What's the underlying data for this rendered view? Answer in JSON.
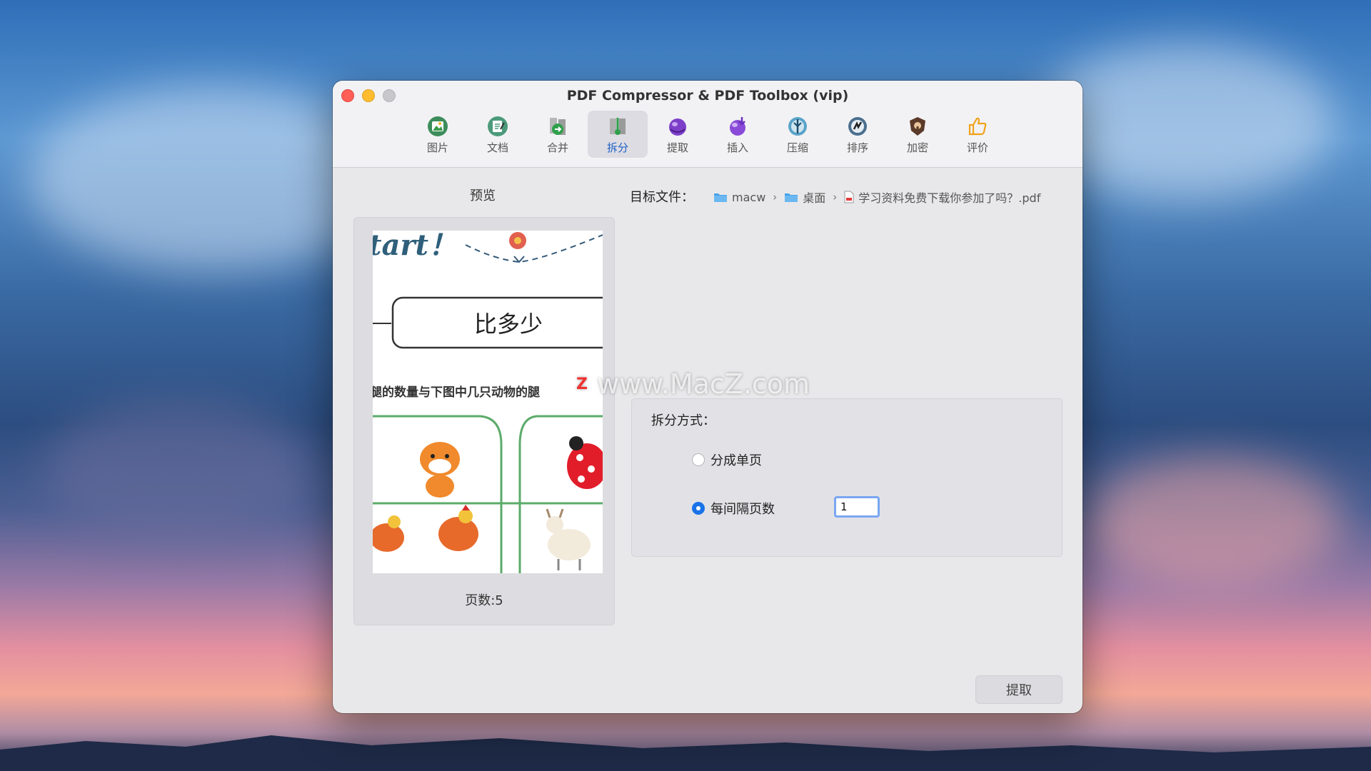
{
  "window": {
    "title": "PDF Compressor & PDF Toolbox (vip)"
  },
  "toolbar": {
    "items": [
      {
        "label": "图片",
        "icon": "image-icon",
        "active": false
      },
      {
        "label": "文档",
        "icon": "document-icon",
        "active": false
      },
      {
        "label": "合并",
        "icon": "merge-icon",
        "active": false
      },
      {
        "label": "拆分",
        "icon": "split-icon",
        "active": true
      },
      {
        "label": "提取",
        "icon": "extract-icon",
        "active": false
      },
      {
        "label": "插入",
        "icon": "insert-icon",
        "active": false
      },
      {
        "label": "压缩",
        "icon": "compress-icon",
        "active": false
      },
      {
        "label": "排序",
        "icon": "sort-icon",
        "active": false
      },
      {
        "label": "加密",
        "icon": "encrypt-icon",
        "active": false
      },
      {
        "label": "评价",
        "icon": "thumbs-up-icon",
        "active": false
      }
    ]
  },
  "preview": {
    "title": "预览",
    "page_count": "页数:5",
    "page_text": {
      "heading": "tart！",
      "box": "比多少",
      "question": "腿的数量与下图中几只动物的腿"
    }
  },
  "target": {
    "label": "目标文件：",
    "path": [
      {
        "name": "macw",
        "icon": "folder-icon"
      },
      {
        "name": "桌面",
        "icon": "folder-icon"
      },
      {
        "name": "学习资料免费下载你参加了吗？.pdf",
        "icon": "pdf-file-icon"
      }
    ]
  },
  "split": {
    "label": "拆分方式：",
    "option_single": "分成单页",
    "option_every": "每间隔页数",
    "selected": "option_every",
    "interval_value": "1"
  },
  "actions": {
    "extract_label": "提取"
  },
  "watermark": {
    "z": "Z",
    "text": "www.MacZ.com"
  },
  "colors": {
    "accent": "#1a73e8",
    "active_tab_text": "#1c5fc7"
  }
}
